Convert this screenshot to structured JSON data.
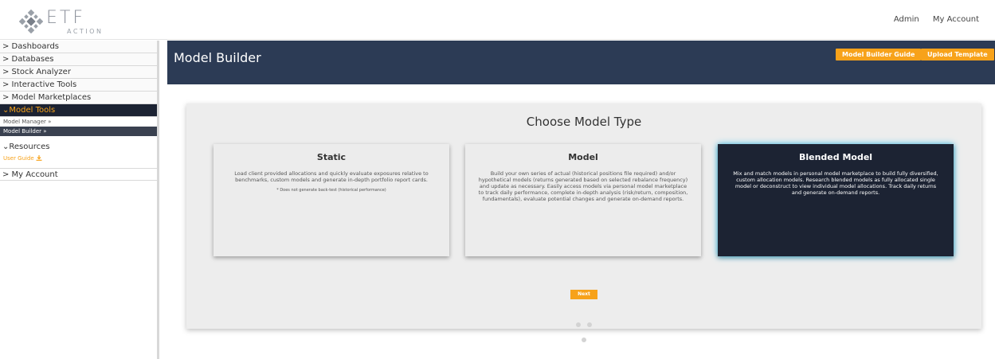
{
  "brand": {
    "name": "ETF",
    "tagline": "ACTION",
    "logo_icon": "diamond-logo-icon"
  },
  "top_nav": {
    "admin": "Admin",
    "account": "My Account"
  },
  "sidebar": {
    "items": [
      {
        "label": "> Dashboards"
      },
      {
        "label": "> Databases"
      },
      {
        "label": "> Stock Analyzer"
      },
      {
        "label": "> Interactive Tools"
      },
      {
        "label": "> Model Marketplaces"
      },
      {
        "label": "⌄Model Tools"
      }
    ],
    "model_tools_sub": [
      "Model Manager »",
      "Model Builder »"
    ],
    "resources": "⌄Resources",
    "user_guide": "User Guide",
    "my_account": "> My Account"
  },
  "header": {
    "title": "Model Builder",
    "guide_button": "Model Builder Guide",
    "upload_button": "Upload Template"
  },
  "chooser": {
    "heading": "Choose Model Type",
    "cards": [
      {
        "title": "Static",
        "description": "Load client provided allocations and quickly evaluate exposures relative to benchmarks, custom models and generate in-depth portfolio report cards.",
        "note": "* Does not generate back-test (historical performance)"
      },
      {
        "title": "Model",
        "description": "Build your own series of actual (historical positions file required) and/or hypothetical models (returns generated based on selected rebalance frequency) and update as necessary. Easily access models via personal model marketplace to track daily performance, complete in-depth analysis (risk/return, composition, fundamentals), evaluate potential changes and generate on-demand reports."
      },
      {
        "title": "Blended Model",
        "description": "Mix and match models in personal model marketplace to build fully diversified, custom allocation models. Research blended models as fully allocated single model or deconstruct to view individual model allocations. Track daily returns and generate on-demand reports."
      }
    ],
    "next_button": "Next"
  },
  "colors": {
    "accent": "#f7a21a",
    "header_bg": "#2c3b55",
    "selected_card": "#1c2333",
    "glow": "#3fc3ee"
  }
}
